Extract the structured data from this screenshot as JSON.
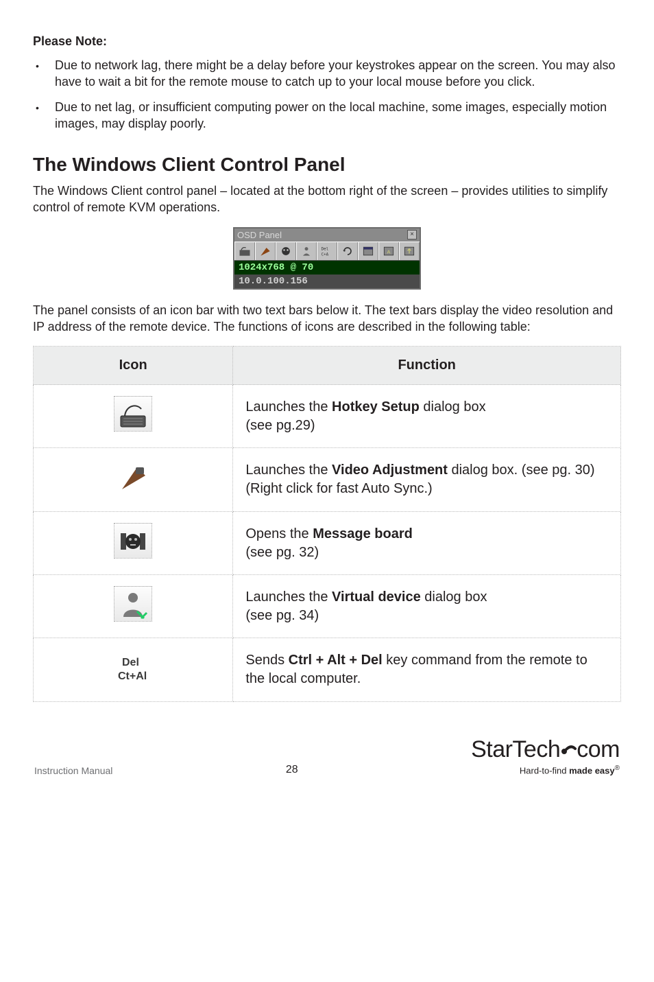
{
  "note_heading": "Please Note:",
  "bullets": [
    "Due to network lag, there might be a delay before your keystrokes appear on the screen. You may also have to wait a bit for the remote mouse to catch up to your local mouse before you click.",
    "Due to net lag, or insufficient computing power on the local machine, some images, especially motion images, may display poorly."
  ],
  "section_heading": "The Windows Client Control Panel",
  "section_intro": "The Windows Client control panel – located at the bottom right of the screen – provides utilities to simplify control of remote KVM operations.",
  "osd": {
    "title": "OSD Panel",
    "resolution": "1024x768 @ 70",
    "ip": "10.0.100.156"
  },
  "panel_desc": "The panel consists of an icon bar with two text bars below it. The text bars display the video resolution and IP address of the remote device. The functions of icons are described in the following table:",
  "table": {
    "headers": {
      "icon": "Icon",
      "func": "Function"
    },
    "rows": [
      {
        "icon": "hotkey",
        "pre": "Launches the ",
        "bold": "Hotkey Setup",
        "post": " dialog box",
        "line2": "(see pg.29)"
      },
      {
        "icon": "video",
        "pre": "Launches the ",
        "bold": "Video Adjustment",
        "post": " dialog box. (see pg. 30)",
        "line2": "(Right click for fast Auto Sync.)"
      },
      {
        "icon": "message",
        "pre": "Opens the ",
        "bold": "Message board",
        "post": "",
        "line2": "(see pg. 32)"
      },
      {
        "icon": "virtual",
        "pre": "Launches the ",
        "bold": "Virtual device",
        "post": " dialog box",
        "line2": "(see pg. 34)"
      },
      {
        "icon": "cad",
        "pre": "Sends ",
        "bold": "Ctrl + Alt + Del",
        "post": " key command from the remote to the local computer.",
        "line2": ""
      }
    ]
  },
  "footer": {
    "manual": "Instruction Manual",
    "page": "28",
    "brand1": "StarTech",
    "brand2": "com",
    "tag_pre": "Hard-to-find ",
    "tag_bold": "made easy",
    "reg": "®"
  }
}
